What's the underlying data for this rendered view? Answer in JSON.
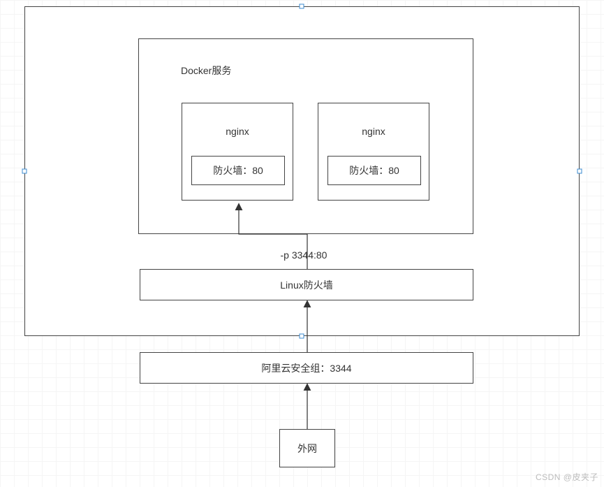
{
  "diagram": {
    "outer_box": {
      "label": ""
    },
    "docker_box": {
      "title": "Docker服务"
    },
    "container_left": {
      "title": "nginx",
      "firewall": "防火墙：80"
    },
    "container_right": {
      "title": "nginx",
      "firewall": "防火墙：80"
    },
    "port_mapping": "-p 3344:80",
    "linux_firewall": "Linux防火墙",
    "security_group": "阿里云安全组：3344",
    "external": "外网"
  },
  "watermark": "CSDN @皮夹子"
}
